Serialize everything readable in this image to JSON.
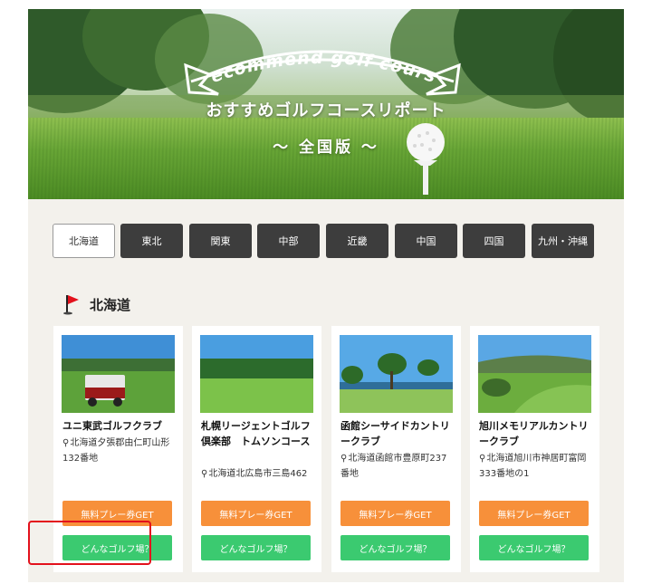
{
  "hero": {
    "banner_text": "Recommend golf course",
    "title": "おすすめゴルフコースリポート",
    "subtitle": "～ 全国版 ～"
  },
  "tabs": [
    {
      "label": "北海道",
      "active": true
    },
    {
      "label": "東北",
      "active": false
    },
    {
      "label": "関東",
      "active": false
    },
    {
      "label": "中部",
      "active": false
    },
    {
      "label": "近畿",
      "active": false
    },
    {
      "label": "中国",
      "active": false
    },
    {
      "label": "四国",
      "active": false
    },
    {
      "label": "九州・沖縄",
      "active": false
    }
  ],
  "section": {
    "title": "北海道",
    "icon": "red-flag-icon"
  },
  "cards": [
    {
      "name": "ユニ東武ゴルフクラブ",
      "address": "北海道夕張郡由仁町山形132番地",
      "free_play_label": "無料プレー券GET",
      "details_label": "どんなゴルフ場？"
    },
    {
      "name": "札幌リージェントゴルフ倶楽部　トムソンコース",
      "address": "北海道北広島市三島462",
      "free_play_label": "無料プレー券GET",
      "details_label": "どんなゴルフ場？"
    },
    {
      "name": "函館シーサイドカントリークラブ",
      "address": "北海道函館市豊原町237番地",
      "free_play_label": "無料プレー券GET",
      "details_label": "どんなゴルフ場？"
    },
    {
      "name": "旭川メモリアルカントリークラブ",
      "address": "北海道旭川市神居町富岡333番地の1",
      "free_play_label": "無料プレー券GET",
      "details_label": "どんなゴルフ場？"
    }
  ],
  "colors": {
    "tab_dark": "#3d3d3d",
    "button_orange": "#f7903a",
    "button_green": "#3bca70",
    "highlight_red": "#e3111c"
  }
}
